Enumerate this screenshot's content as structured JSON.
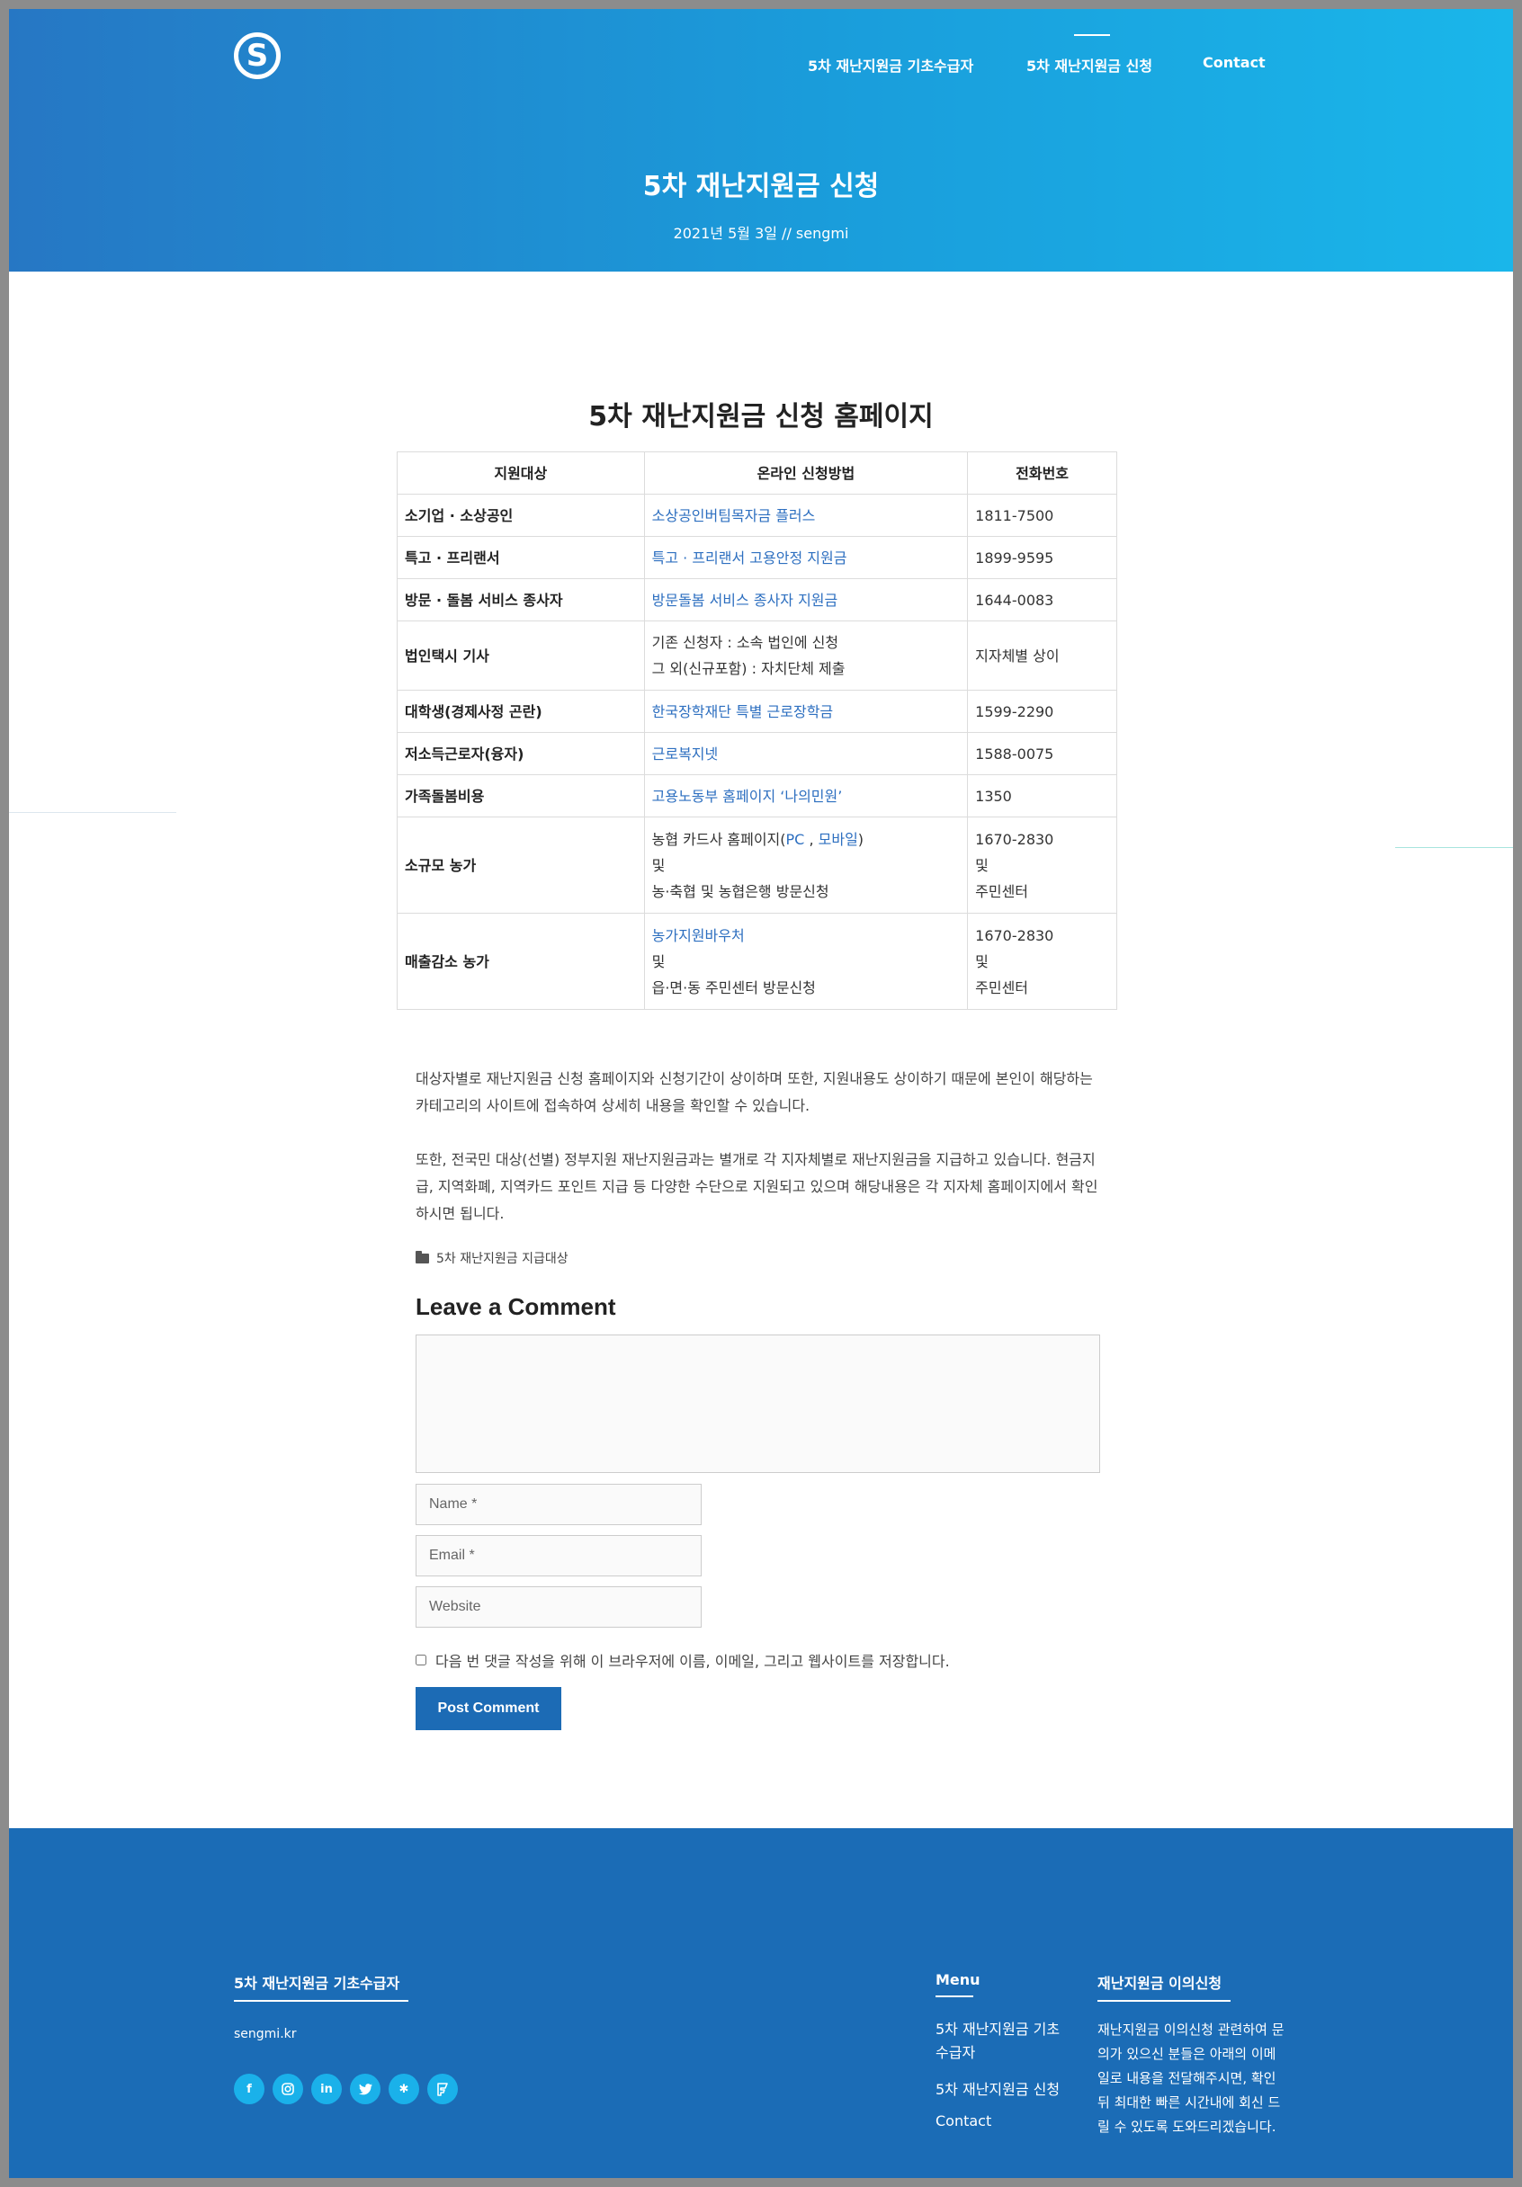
{
  "header": {
    "logo_letter": "S",
    "nav": [
      "5차 재난지원금 기초수급자",
      "5차 재난지원금 신청",
      "Contact"
    ],
    "title": "5차 재난지원금 신청",
    "meta": "2021년 5월 3일 // sengmi"
  },
  "content": {
    "heading": "5차 재난지원금 신청 홈페이지",
    "table": {
      "headers": [
        "지원대상",
        "온라인 신청방법",
        "전화번호"
      ],
      "rows": [
        {
          "target": "소기업 · 소상공인",
          "method": [
            "소상공인버팀목자금 플러스"
          ],
          "phone": [
            "1811-7500"
          ]
        },
        {
          "target": "특고 · 프리랜서",
          "method": [
            "특고 · 프리랜서 고용안정 지원금"
          ],
          "phone": [
            "1899-9595"
          ]
        },
        {
          "target": "방문 · 돌봄 서비스 종사자",
          "method": [
            "방문돌봄 서비스 종사자 지원금"
          ],
          "phone": [
            "1644-0083"
          ]
        },
        {
          "target": "법인택시 기사",
          "method": [
            "기존 신청자 : 소속 법인에 신청",
            "그 외(신규포함) : 자치단체 제출"
          ],
          "phone": [
            "지자체별 상이"
          ]
        },
        {
          "target": "대학생(경제사정 곤란)",
          "method": [
            "한국장학재단 특별 근로장학금"
          ],
          "phone": [
            "1599-2290"
          ]
        },
        {
          "target": "저소득근로자(융자)",
          "method": [
            "근로복지넷"
          ],
          "phone": [
            "1588-0075"
          ]
        },
        {
          "target": "가족돌봄비용",
          "method": [
            "고용노동부 홈페이지 ‘나의민원’"
          ],
          "phone": [
            "1350"
          ]
        },
        {
          "target": "소규모 농가",
          "method_prefix": "농협 카드사 홈페이지(",
          "method_pc": "PC",
          "method_sep": " , ",
          "method_mobile": "모바일",
          "method_suffix": ")",
          "method": [
            "및",
            "농·축협 및 농협은행 방문신청"
          ],
          "phone": [
            "1670-2830",
            "및",
            "주민센터"
          ]
        },
        {
          "target": "매출감소 농가",
          "method": [
            "농가지원바우처",
            "및",
            "읍·면·동 주민센터 방문신청"
          ],
          "phone": [
            "1670-2830",
            "및",
            "주민센터"
          ]
        }
      ]
    },
    "paragraph1": "대상자별로 재난지원금 신청 홈페이지와 신청기간이 상이하며 또한, 지원내용도 상이하기 때문에 본인이 해당하는 카테고리의 사이트에 접속하여 상세히 내용을 확인할 수 있습니다.",
    "paragraph2": "또한, 전국민 대상(선별) 정부지원 재난지원금과는 별개로 각 지자체별로 재난지원금을 지급하고 있습니다. 현금지급, 지역화폐, 지역카드 포인트 지급 등 다양한 수단으로 지원되고 있으며 해당내용은 각 지자체 홈페이지에서 확인하시면 됩니다.",
    "category": "5차 재난지원금 지급대상"
  },
  "comment": {
    "heading": "Leave a Comment",
    "name_placeholder": "Name *",
    "email_placeholder": "Email *",
    "website_placeholder": "Website",
    "save_label": "다음 번 댓글 작성을 위해 이 브라우저에 이름, 이메일, 그리고 웹사이트를 저장합니다.",
    "submit": "Post Comment"
  },
  "footer": {
    "col1_title": "5차 재난지원금 기초수급자",
    "site": "sengmi.kr",
    "social": [
      "facebook-icon",
      "instagram-icon",
      "linkedin-icon",
      "twitter-icon",
      "yelp-icon",
      "foursquare-icon"
    ],
    "menu_title": "Menu",
    "menu": [
      "5차 재난지원금 기초수급자",
      "5차 재난지원금 신청",
      "Contact"
    ],
    "col3_title": "재난지원금 이의신청",
    "about": "재난지원금 이의신청 관련하여 문의가 있으신 분들은 아래의 이메일로 내용을 전달해주시면, 확인 뒤 최대한 빠른 시간내에 회신 드릴 수 있도록 도와드리겠습니다."
  },
  "colors": {
    "brand_blue": "#1b6cb6",
    "accent_cyan": "#1ab1ea",
    "link": "#2d6fc0"
  }
}
